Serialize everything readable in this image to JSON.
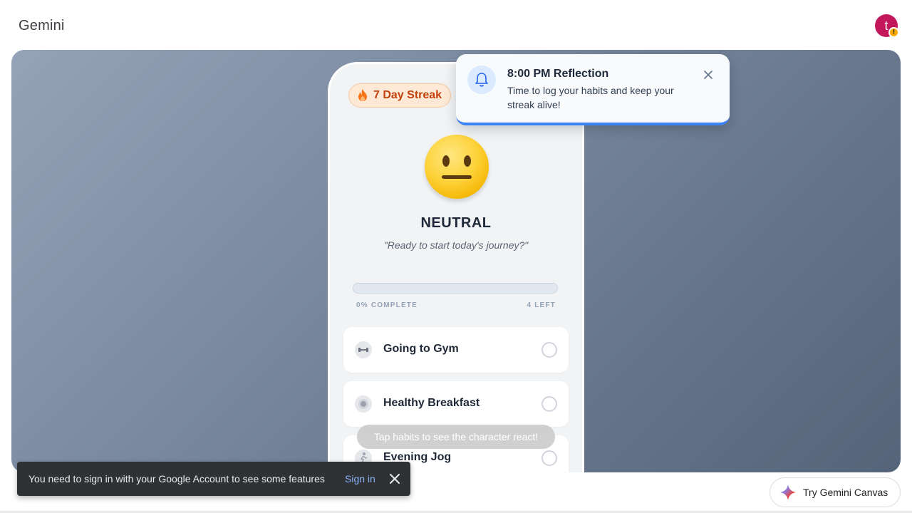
{
  "app": {
    "title": "Gemini",
    "avatar_initial": "t",
    "avatar_warning": "!"
  },
  "colors": {
    "accent": "#3b82f6",
    "streak": "#c2410c",
    "avatar": "#c2185b",
    "snackbar_link": "#8ab4f8"
  },
  "phone": {
    "streak_label": "7 Day Streak",
    "streak_icon": "flame-icon",
    "mood": "NEUTRAL",
    "mood_icon": "neutral-face-icon",
    "quote": "\"Ready to start today's journey?\"",
    "progress": {
      "percent": 0,
      "complete_label": "0% COMPLETE",
      "left_label": "4 LEFT"
    },
    "habits": [
      {
        "name": "Going to Gym",
        "icon": "dumbbell-icon",
        "done": false
      },
      {
        "name": "Healthy Breakfast",
        "icon": "food-icon",
        "done": false
      },
      {
        "name": "Evening Jog",
        "icon": "runner-icon",
        "done": false
      }
    ],
    "hint": "Tap habits to see the character react!"
  },
  "notification": {
    "icon": "bell-icon",
    "title": "8:00 PM Reflection",
    "body": "Time to log your habits and keep your streak alive!"
  },
  "snackbar": {
    "message": "You need to sign in with your Google Account to see some features",
    "action": "Sign in"
  },
  "canvas_button": {
    "label": "Try Gemini Canvas",
    "icon": "gemini-sparkle-icon"
  }
}
